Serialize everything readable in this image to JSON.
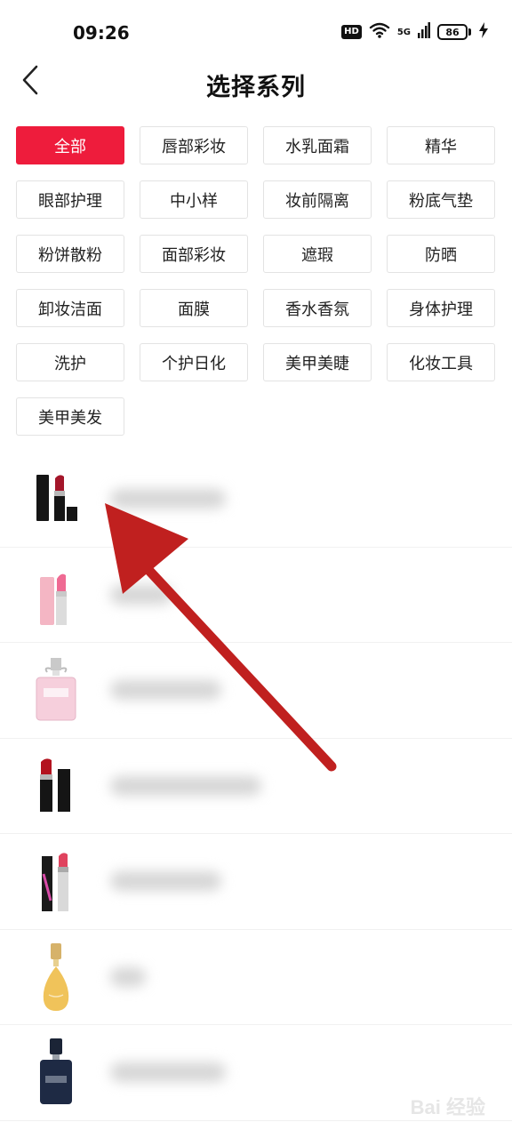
{
  "status_bar": {
    "time": "09:26",
    "hd_label": "HD",
    "network_label": "5G",
    "battery_level": "86"
  },
  "header": {
    "title": "选择系列",
    "back_icon": "chevron-left-icon"
  },
  "categories": [
    {
      "label": "全部",
      "selected": true
    },
    {
      "label": "唇部彩妆",
      "selected": false
    },
    {
      "label": "水乳面霜",
      "selected": false
    },
    {
      "label": "精华",
      "selected": false
    },
    {
      "label": "眼部护理",
      "selected": false
    },
    {
      "label": "中小样",
      "selected": false
    },
    {
      "label": "妆前隔离",
      "selected": false
    },
    {
      "label": "粉底气垫",
      "selected": false
    },
    {
      "label": "粉饼散粉",
      "selected": false
    },
    {
      "label": "面部彩妆",
      "selected": false
    },
    {
      "label": "遮瑕",
      "selected": false
    },
    {
      "label": "防晒",
      "selected": false
    },
    {
      "label": "卸妆洁面",
      "selected": false
    },
    {
      "label": "面膜",
      "selected": false
    },
    {
      "label": "香水香氛",
      "selected": false
    },
    {
      "label": "身体护理",
      "selected": false
    },
    {
      "label": "洗护",
      "selected": false
    },
    {
      "label": "个护日化",
      "selected": false
    },
    {
      "label": "美甲美睫",
      "selected": false
    },
    {
      "label": "化妆工具",
      "selected": false
    },
    {
      "label": "美甲美发",
      "selected": false
    }
  ],
  "products": [
    {
      "image": "lipstick-black-icon",
      "name_blurred": true,
      "name_width": 130
    },
    {
      "image": "lip-balm-pink-icon",
      "name_blurred": true,
      "name_width": 70
    },
    {
      "image": "perfume-pink-bottle-icon",
      "name_blurred": true,
      "name_width": 125
    },
    {
      "image": "lipstick-red-icon",
      "name_blurred": true,
      "name_width": 170
    },
    {
      "image": "lipstick-addict-icon",
      "name_blurred": true,
      "name_width": 125
    },
    {
      "image": "perfume-gold-icon",
      "name_blurred": true,
      "name_width": 40
    },
    {
      "image": "perfume-dark-blue-icon",
      "name_blurred": true,
      "name_width": 130
    }
  ],
  "colors": {
    "accent": "#ee1c3c",
    "annotation_arrow": "#c0201f"
  },
  "watermark": "Bai 经验"
}
